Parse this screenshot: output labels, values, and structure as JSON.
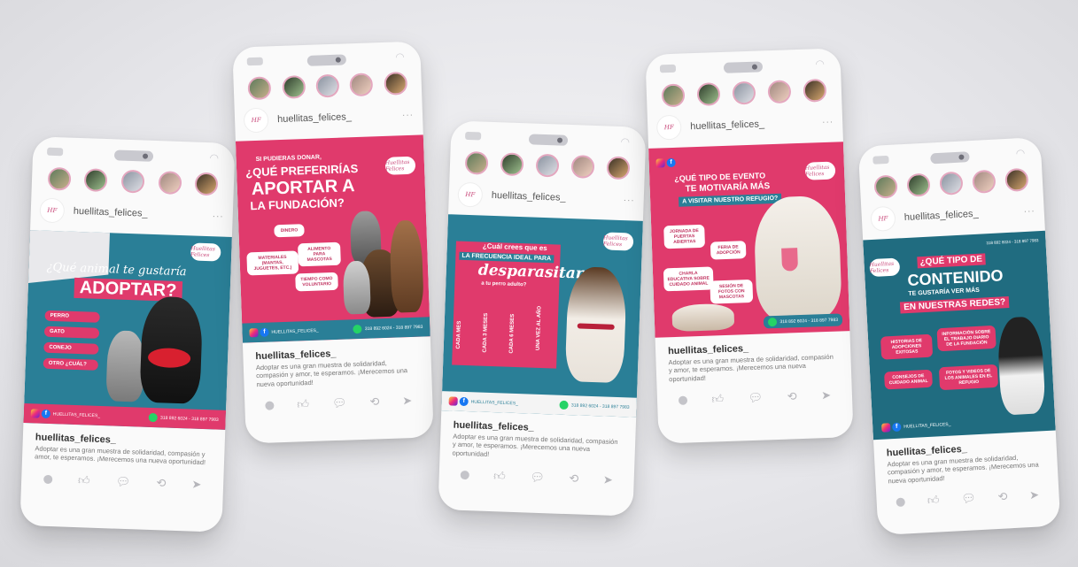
{
  "username": "huellitas_felices_",
  "caption_text": "Adoptar es una gran muestra de solidaridad, compasión y amor, te esperamos. ¡Merecemos una nueva oportunidad!",
  "logo_text": "Huellitas Felices",
  "footer_handle": "HUELLITAS_FELICES_",
  "footer_phone": "318 892 6024 - 318 897 7983",
  "colors": {
    "pink": "#e03a6c",
    "teal": "#2a7f97",
    "dark_teal": "#206c80"
  },
  "posts": {
    "adopt": {
      "line1": "¿Qué animal te gustaría",
      "line2": "ADOPTAR?",
      "options": [
        "PERRO",
        "GATO",
        "CONEJO",
        "OTRO ¿CUÁL?"
      ]
    },
    "donate": {
      "line1": "SI PUDIERAS DONAR,",
      "line2": "¿QUÉ PREFERIRÍAS",
      "line3": "APORTAR A",
      "line4": "LA FUNDACIÓN?",
      "options": [
        "DINERO",
        "ALIMENTO PARA MASCOTAS",
        "MATERIALES (MANTAS, JUGUETES, ETC.)",
        "TIEMPO COMO VOLUNTARIO"
      ]
    },
    "deworm": {
      "line1": "¿Cuál crees que es",
      "line2": "LA FRECUENCIA IDEAL PARA",
      "line3": "desparasitar",
      "line4": "a tu perro adulto?",
      "options": [
        "CADA MES",
        "CADA 3 MESES",
        "CADA 6 MESES",
        "UNA VEZ AL AÑO"
      ]
    },
    "event": {
      "line1": "¿QUÉ TIPO DE EVENTO",
      "line2": "TE MOTIVARÍA MÁS",
      "line3": "A VISITAR NUESTRO REFUGIO?",
      "options": [
        "JORNADA DE PUERTAS ABIERTAS",
        "FERIA DE ADOPCIÓN",
        "CHARLA EDUCATIVA SOBRE CUIDADO ANIMAL",
        "SESIÓN DE FOTOS CON MASCOTAS"
      ]
    },
    "content": {
      "line1": "¿QUÉ TIPO DE",
      "line2": "CONTENIDO",
      "line3": "TE GUSTARÍA VER MÁS",
      "line4": "EN NUESTRAS REDES?",
      "options": [
        "HISTORIAS DE ADOPCIONES EXITOSAS",
        "INFORMACIÓN SOBRE EL TRABAJO DIARIO DE LA FUNDACIÓN",
        "CONSEJOS DE CUIDADO ANIMAL",
        "FOTOS Y VIDEOS DE LOS ANIMALES EN EL REFUGIO"
      ]
    }
  }
}
